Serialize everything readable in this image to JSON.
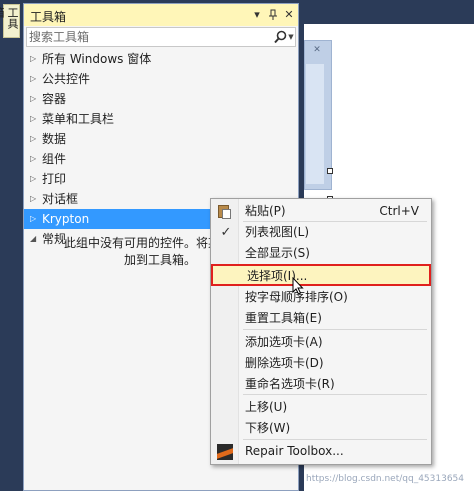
{
  "side_tab": {
    "label": "工具箱"
  },
  "toolbox": {
    "title": "工具箱",
    "title_buttons": {
      "dropdown": "▾",
      "pin": "ᵖ",
      "close": "✕"
    },
    "search_placeholder": "搜索工具箱",
    "groups": [
      {
        "label": "所有 Windows 窗体",
        "expanded": false,
        "selected": false
      },
      {
        "label": "公共控件",
        "expanded": false,
        "selected": false
      },
      {
        "label": "容器",
        "expanded": false,
        "selected": false
      },
      {
        "label": "菜单和工具栏",
        "expanded": false,
        "selected": false
      },
      {
        "label": "数据",
        "expanded": false,
        "selected": false
      },
      {
        "label": "组件",
        "expanded": false,
        "selected": false
      },
      {
        "label": "打印",
        "expanded": false,
        "selected": false
      },
      {
        "label": "对话框",
        "expanded": false,
        "selected": false
      },
      {
        "label": "Krypton",
        "expanded": false,
        "selected": true
      },
      {
        "label": "常规",
        "expanded": true,
        "selected": false
      }
    ],
    "empty_message_line1": "此组中没有可用的控件。将某项拖至",
    "empty_message_line2": "加到工具箱。"
  },
  "context_menu": {
    "items": [
      {
        "label": "粘贴(P)",
        "shortcut": "Ctrl+V",
        "icon": "paste-icon"
      },
      {
        "label": "列表视图(L)",
        "icon": "checkmark-icon",
        "checked": true
      },
      {
        "label": "全部显示(S)"
      },
      {
        "label": "选择项(I)...",
        "highlighted": true
      },
      {
        "label": "按字母顺序排序(O)"
      },
      {
        "label": "重置工具箱(E)"
      },
      {
        "label": "添加选项卡(A)"
      },
      {
        "label": "删除选项卡(D)"
      },
      {
        "label": "重命名选项卡(R)"
      },
      {
        "label": "上移(U)"
      },
      {
        "label": "下移(W)"
      },
      {
        "label": "Repair Toolbox...",
        "icon": "repair-toolbox-icon"
      }
    ],
    "check_glyph": "✓"
  },
  "watermark": "https://blog.csdn.net/qq_45313654",
  "colors": {
    "title_bar": "#fff6b8",
    "selection": "#3399ff",
    "highlight_border": "#e0201d",
    "highlight_fill": "#fdf4bf",
    "background": "#2b3b58"
  }
}
